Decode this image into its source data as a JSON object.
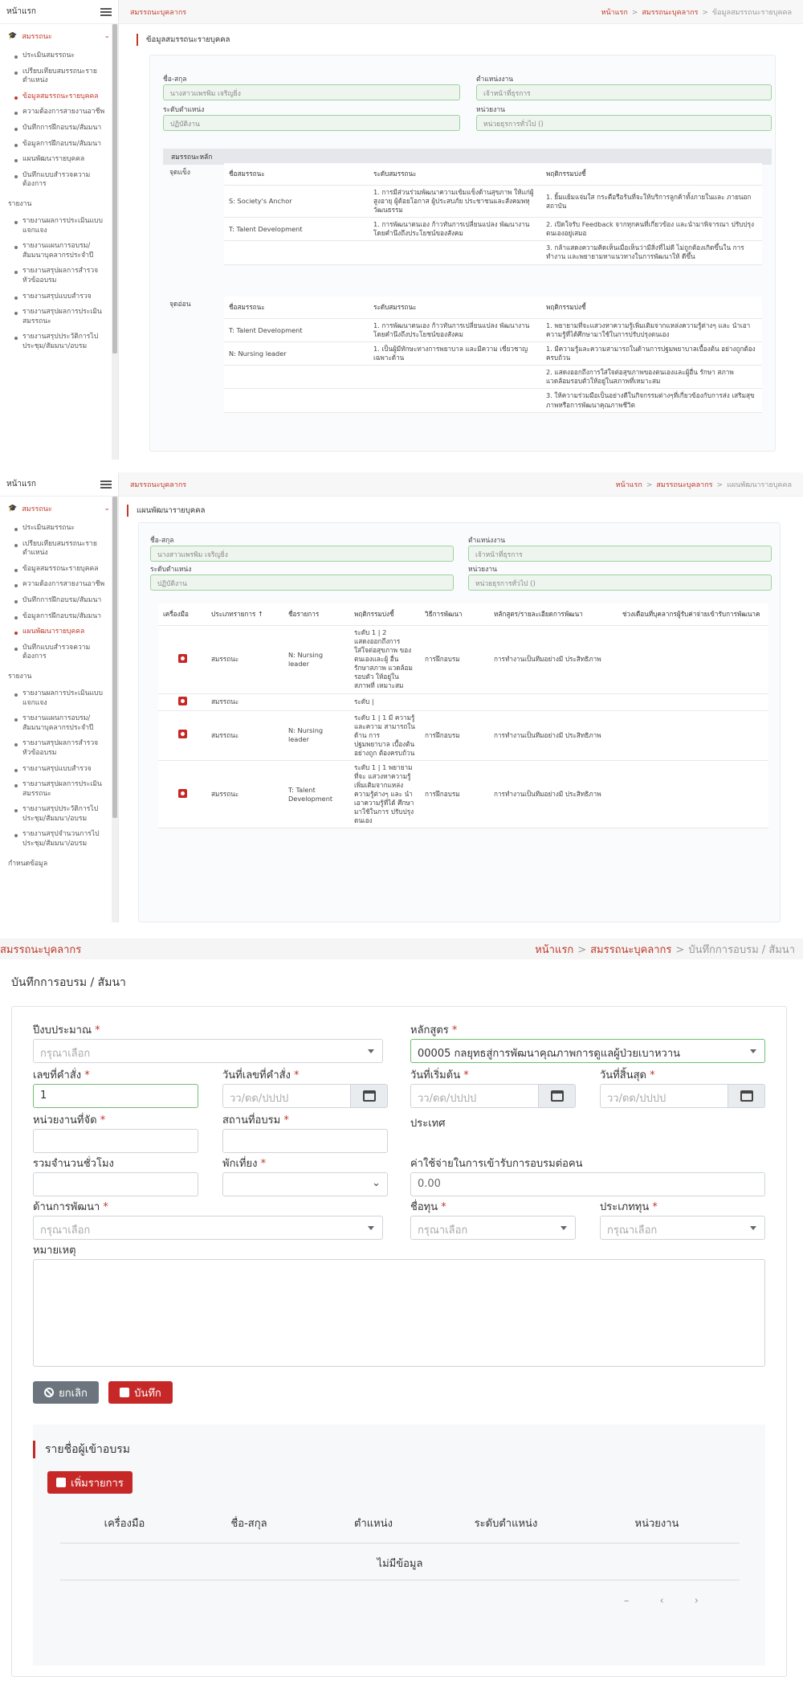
{
  "app": {
    "home": "หน้าแรก",
    "menu_group": "สมรรถนะ",
    "brand": "สมรรถนะบุคลากร"
  },
  "sidebar": {
    "items": [
      "ประเมินสมรรถนะ",
      "เปรียบเทียบสมรรถนะราย ตำแหน่ง",
      "ข้อมูลสมรรถนะรายบุคคล",
      "ความต้องการสายงานอาชีพ",
      "บันทึกการฝึกอบรม/สัมมนา",
      "ข้อมูลการฝึกอบรม/สัมมนา",
      "แผนพัฒนารายบุคคล",
      "บันทึกแบบสำรวจความ ต้องการ"
    ],
    "report_section": "รายงาน",
    "reports": [
      "รายงานผลการประเมินแบบ แจกแจง",
      "รายงานแผนการอบรม/ สัมมนาบุคลากรประจำปี",
      "รายงานสรุปผลการสำรวจ หัวข้ออบรม",
      "รายงานสรุปแบบสำรวจ",
      "รายงานสรุปผลการประเมิน สมรรถนะ",
      "รายงานสรุปประวัติการไป ประชุม/สัมมนา/อบรม",
      "รายงานสรุปจำนวนการไป ประชุม/สัมมนา/อบรม"
    ],
    "settings_section": "กำหนดข้อมูล"
  },
  "screen1": {
    "crumb": [
      "หน้าแรก",
      "สมรรถนะบุคลากร",
      "ข้อมูลสมรรถนะรายบุคคล"
    ],
    "title": "ข้อมูลสมรรถนะรายบุคคล",
    "fields": {
      "name_label": "ชื่อ-สกุล",
      "name": "นางสาวแพรพิม เจริญยิ่ง",
      "position_label": "ตำแหน่งงาน",
      "position": "เจ้าหน้าที่ธุรการ",
      "level_label": "ระดับตำแหน่ง",
      "level": "ปฏิบัติงาน",
      "unit_label": "หน่วยงาน",
      "unit": "หน่วยธุรการทั่วไป ()"
    },
    "section": "สมรรถนะหลัก",
    "strength_label": "จุดแข็ง",
    "weak_label": "จุดอ่อน",
    "cols": [
      "ชื่อสมรรถนะ",
      "ระดับสมรรถนะ",
      "พฤติกรรมบ่งชี้"
    ],
    "strengths": [
      [
        "S: Society's Anchor",
        "1. การมีส่วนร่วมพัฒนาความเข้มแข็งด้านสุขภาพ ให้แก่ผู้สูงอายุ ผู้ด้อยโอกาส ผู้ประสบภัย ประชาชนและสังคมพหุวัฒนธรรม",
        "1. ยิ้มแย้มแจ่มใส กระตือรือร้นที่จะให้บริการลูกค้าทั้งภายในและ ภายนอกสถาบัน"
      ],
      [
        "T: Talent Development",
        "1. การพัฒนาตนเอง ก้าวทันการเปลี่ยนแปลง พัฒนางานโดยคำนึงถึงประโยชน์ของสังคม",
        "2. เปิดใจรับ Feedback จากทุกคนที่เกี่ยวข้อง และนำมาพิจารณา ปรับปรุงตนเองอยู่เสมอ"
      ],
      [
        "",
        "",
        "3. กล้าแสดงความคิดเห็นเมื่อเห็นว่ามีสิ่งที่ไม่ดี ไม่ถูกต้องเกิดขึ้นใน การทำงาน และพยายามหาแนวทางในการพัฒนาให้ ดีขึ้น"
      ]
    ],
    "weaknesses": [
      [
        "T: Talent Development",
        "1. การพัฒนาตนเอง ก้าวทันการเปลี่ยนแปลง พัฒนางานโดยคำนึงถึงประโยชน์ของสังคม",
        "1. พยายามที่จะแสวงหาความรู้เพิ่มเติมจากแหล่งความรู้ต่างๆ และ นำเอาความรู้ที่ได้ศึกษามาใช้ในการปรับปรุงตนเอง"
      ],
      [
        "N: Nursing leader",
        "1. เป็นผู้มีทักษะทางการพยาบาล และมีความ เชี่ยวชาญเฉพาะด้าน",
        "1. มีความรู้และความสามารถในด้านการปฐมพยาบาลเบื้องต้น อย่างถูกต้องครบถ้วน"
      ],
      [
        "",
        "",
        "2. แสดงออกถึงการใส่ใจต่อสุขภาพของตนเองและผู้อื่น รักษา สภาพแวดล้อมรอบตัวให้อยู่ในสภาพที่เหมาะสม"
      ],
      [
        "",
        "",
        "3. ให้ความร่วมมือเป็นอย่างดีในกิจกรรมต่างๆที่เกี่ยวข้องกับการส่ง เสริมสุขภาพหรือการพัฒนาคุณภาพชีวิต"
      ]
    ]
  },
  "screen2": {
    "crumb": [
      "หน้าแรก",
      "สมรรถนะบุคลากร",
      "แผนพัฒนารายบุคคล"
    ],
    "title": "แผนพัฒนารายบุคคล",
    "fields": {
      "name_label": "ชื่อ-สกุล",
      "name": "นางสาวแพรพิม เจริญยิ่ง",
      "position_label": "ตำแหน่งงาน",
      "position": "เจ้าหน้าที่ธุรการ",
      "level_label": "ระดับตำแหน่ง",
      "level": "ปฏิบัติงาน",
      "unit_label": "หน่วยงาน",
      "unit": "หน่วยธุรการทั่วไป ()"
    },
    "cols": [
      "เครื่องมือ",
      "ประเภทรายการ",
      "ชื่อรายการ",
      "พฤติกรรมบ่งชี้",
      "วิธีการพัฒนา",
      "หลักสูตร/รายละเอียดการพัฒนา",
      "ช่วงเดือนที่บุคลากรผู้รับค่าจ่ายเข้ารับการพัฒนาค"
    ],
    "rows": [
      [
        "สมรรถนะ",
        "N: Nursing leader",
        "ระดับ 1 | 2 แสดงออกถึงการ ใส่ใจต่อสุขภาพ ของตนเองและผู้ อื่น รักษาสภาพ แวดล้อมรอบตัว ให้อยู่ในสภาพที่ เหมาะสม",
        "การฝึกอบรม",
        "การทำงานเป็นทีมอย่างมี ประสิทธิภาพ"
      ],
      [
        "สมรรถนะ",
        "",
        "ระดับ |",
        "",
        ""
      ],
      [
        "สมรรถนะ",
        "N: Nursing leader",
        "ระดับ 1 | 1 มี ความรู้และความ สามารถในด้าน การปฐมพยาบาล เบื้องต้นอย่างถูก ต้องครบถ้วน",
        "การฝึกอบรม",
        "การทำงานเป็นทีมอย่างมี ประสิทธิภาพ"
      ],
      [
        "สมรรถนะ",
        "T: Talent Development",
        "ระดับ 1 | 1 พยายามที่จะ แสวงหาความรู้ เพิ่มเติมจากแหล่ง ความรู้ต่างๆ และ นำเอาความรู้ที่ได้ ศึกษามาใช้ในการ ปรับปรุงตนเอง",
        "การฝึกอบรม",
        "การทำงานเป็นทีมอย่างมี ประสิทธิภาพ"
      ]
    ]
  },
  "screen3": {
    "brand": "สมรรถนะบุคลากร",
    "crumb": [
      "หน้าแรก",
      "สมรรถนะบุคลากร",
      "บันทึกการอบรม / สัมนา"
    ],
    "title": "บันทึกการอบรม / สัมนา",
    "labels": {
      "budget_year": "ปีงบประมาณ",
      "course": "หลักสูตร",
      "order_no": "เลขที่คำสั่ง",
      "order_date": "วันที่เลขที่คำสั่ง",
      "start_date": "วันที่เริ่มต้น",
      "end_date": "วันที่สิ้นสุด",
      "organizer": "หน่วยงานที่จัด",
      "venue": "สถานที่อบรม",
      "country": "ประเทศ",
      "total_hours": "รวมจำนวนชั่วโมง",
      "overnight": "พักเที่ยง",
      "cost": "ค่าใช้จ่ายในการเข้ารับการอบรมต่อคน",
      "dev_area": "ด้านการพัฒนา",
      "fund_name": "ชื่อทุน",
      "fund_type": "ประเภททุน",
      "remark": "หมายเหตุ"
    },
    "values": {
      "budget_placeholder": "กรุณาเลือก",
      "course": "00005 กลยุทธสู่การพัฒนาคุณภาพการดูแลผู้ป่วยเบาหวาน",
      "order_no": "1",
      "date_placeholder": "วว/ดด/ปปปป",
      "cost": "0.00",
      "select_placeholder": "กรุณาเลือก"
    },
    "buttons": {
      "cancel": "ยกเลิก",
      "save": "บันทึก",
      "add": "เพิ่มรายการ"
    },
    "attendees": {
      "title": "รายชื่อผู้เข้าอบรม",
      "cols": [
        "เครื่องมือ",
        "ชื่อ-สกุล",
        "ตำแหน่ง",
        "ระดับตำแหน่ง",
        "หน่วยงาน"
      ],
      "empty": "ไม่มีข้อมูล",
      "pager": [
        "–",
        "‹",
        "›"
      ]
    }
  }
}
